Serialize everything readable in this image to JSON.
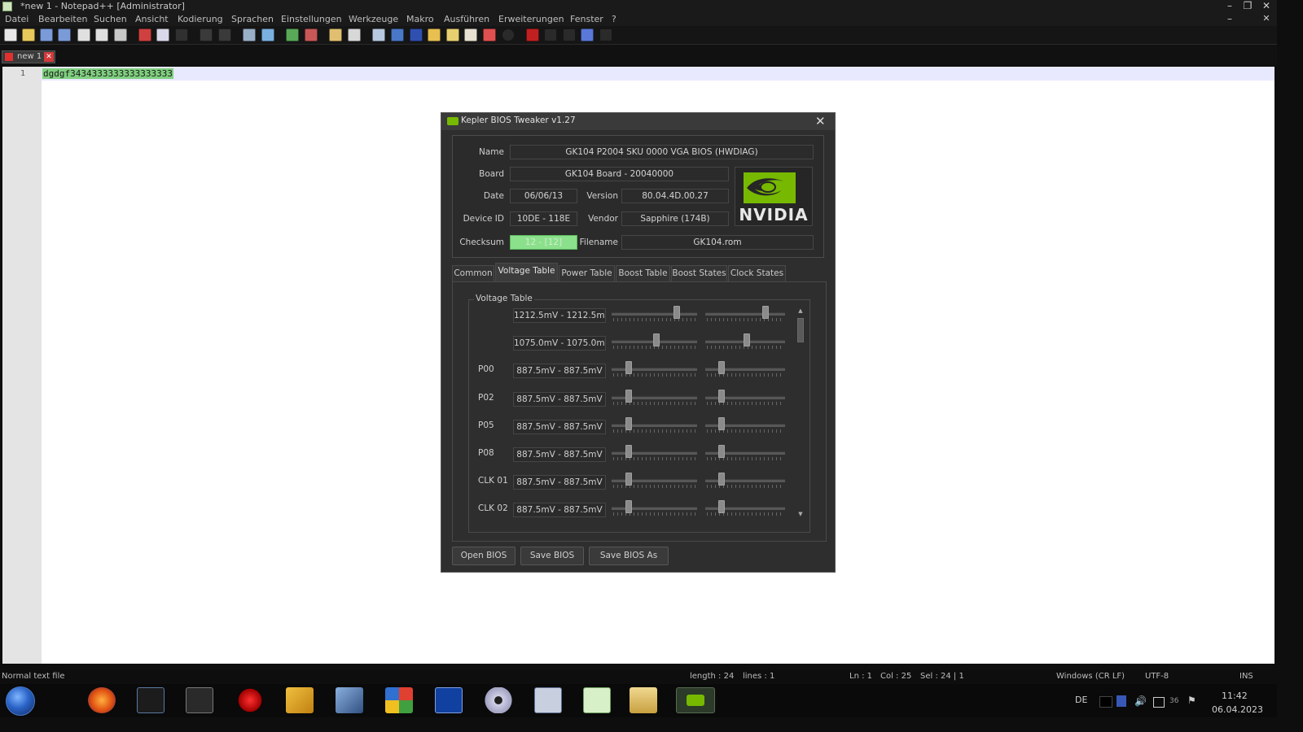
{
  "window": {
    "title": "*new 1 - Notepad++ [Administrator]",
    "controls": {
      "minimize": "–",
      "restore": "❐",
      "close": "✕"
    },
    "inner_controls": {
      "minimize": "–",
      "close": "✕"
    }
  },
  "menu": [
    "Datei",
    "Bearbeiten",
    "Suchen",
    "Ansicht",
    "Kodierung",
    "Sprachen",
    "Einstellungen",
    "Werkzeuge",
    "Makro",
    "Ausführen",
    "Erweiterungen",
    "Fenster",
    "?"
  ],
  "toolbar_icons": [
    "new-file-icon",
    "open-file-icon",
    "save-icon",
    "save-all-icon",
    "close-icon",
    "close-all-icon",
    "print-icon",
    "cut-icon",
    "copy-icon",
    "paste-icon",
    "undo-icon",
    "redo-icon",
    "find-icon",
    "replace-icon",
    "zoom-in-icon",
    "zoom-out-icon",
    "sync-vertical-icon",
    "sync-horizontal-icon",
    "word-wrap-icon",
    "show-all-chars-icon",
    "indent-guide-icon",
    "doc-map-icon",
    "function-list-icon",
    "folder-workspace-icon",
    "monitoring-icon",
    "record-macro-icon",
    "stop-macro-icon",
    "play-macro-icon",
    "run-macro-multiple-icon",
    "save-macro-icon"
  ],
  "doc_tab": {
    "label": "new 1",
    "close": "✕"
  },
  "editor": {
    "line_number": "1",
    "text": "dgdgf3434333333333333333"
  },
  "status": {
    "file_type": "Normal text file",
    "length": "length : 24",
    "lines": "lines : 1",
    "ln": "Ln : 1",
    "col": "Col : 25",
    "sel": "Sel : 24 | 1",
    "eol": "Windows (CR LF)",
    "encoding": "UTF-8",
    "mode": "INS"
  },
  "dialog": {
    "title": "Kepler BIOS Tweaker v1.27",
    "close": "✕",
    "labels": {
      "name": "Name",
      "board": "Board",
      "date": "Date",
      "version": "Version",
      "device_id": "Device ID",
      "vendor": "Vendor",
      "checksum": "Checksum",
      "filename": "Filename"
    },
    "values": {
      "name": "GK104 P2004 SKU 0000 VGA BIOS (HWDIAG)",
      "board": "GK104 Board - 20040000",
      "date": "06/06/13",
      "version": "80.04.4D.00.27",
      "device_id": "10DE - 118E",
      "vendor": "Sapphire (174B)",
      "checksum": "12 - [12]",
      "filename": "GK104.rom"
    },
    "logo_text": "NVIDIA",
    "tabs": [
      "Common",
      "Voltage Table",
      "Power Table",
      "Boost Table",
      "Boost States",
      "Clock States"
    ],
    "active_tab": "Voltage Table",
    "group_label": "Voltage Table",
    "voltage_rows": [
      {
        "label": "",
        "value": "1212.5mV - 1212.5mV",
        "slider1": 0.78,
        "slider2": 0.78
      },
      {
        "label": "",
        "value": "1075.0mV - 1075.0mV",
        "slider1": 0.53,
        "slider2": 0.52
      },
      {
        "label": "P00",
        "value": "887.5mV - 887.5mV",
        "slider1": 0.18,
        "slider2": 0.18
      },
      {
        "label": "P02",
        "value": "887.5mV - 887.5mV",
        "slider1": 0.18,
        "slider2": 0.18
      },
      {
        "label": "P05",
        "value": "887.5mV - 887.5mV",
        "slider1": 0.18,
        "slider2": 0.18
      },
      {
        "label": "P08",
        "value": "887.5mV - 887.5mV",
        "slider1": 0.18,
        "slider2": 0.18
      },
      {
        "label": "CLK 01",
        "value": "887.5mV - 887.5mV",
        "slider1": 0.18,
        "slider2": 0.18
      },
      {
        "label": "CLK 02",
        "value": "887.5mV - 887.5mV",
        "slider1": 0.18,
        "slider2": 0.18
      }
    ],
    "buttons": {
      "open": "Open BIOS",
      "save": "Save BIOS",
      "save_as": "Save BIOS As"
    },
    "scroll": {
      "up": "▲",
      "down": "▼"
    }
  },
  "taskbar": {
    "apps": [
      "firefox-icon",
      "terminal-icon",
      "cpu-z-icon",
      "crash-tool-icon",
      "power-tool-icon",
      "network-tool-icon",
      "windows-explorer-icon",
      "pe-tool-icon",
      "disc-tool-icon",
      "hex-editor-icon",
      "notepadpp-icon",
      "file-explorer-icon",
      "nvidia-app-icon"
    ],
    "tray": {
      "lang": "DE",
      "temp": "36",
      "time": "11:42",
      "date": "06.04.2023"
    }
  }
}
